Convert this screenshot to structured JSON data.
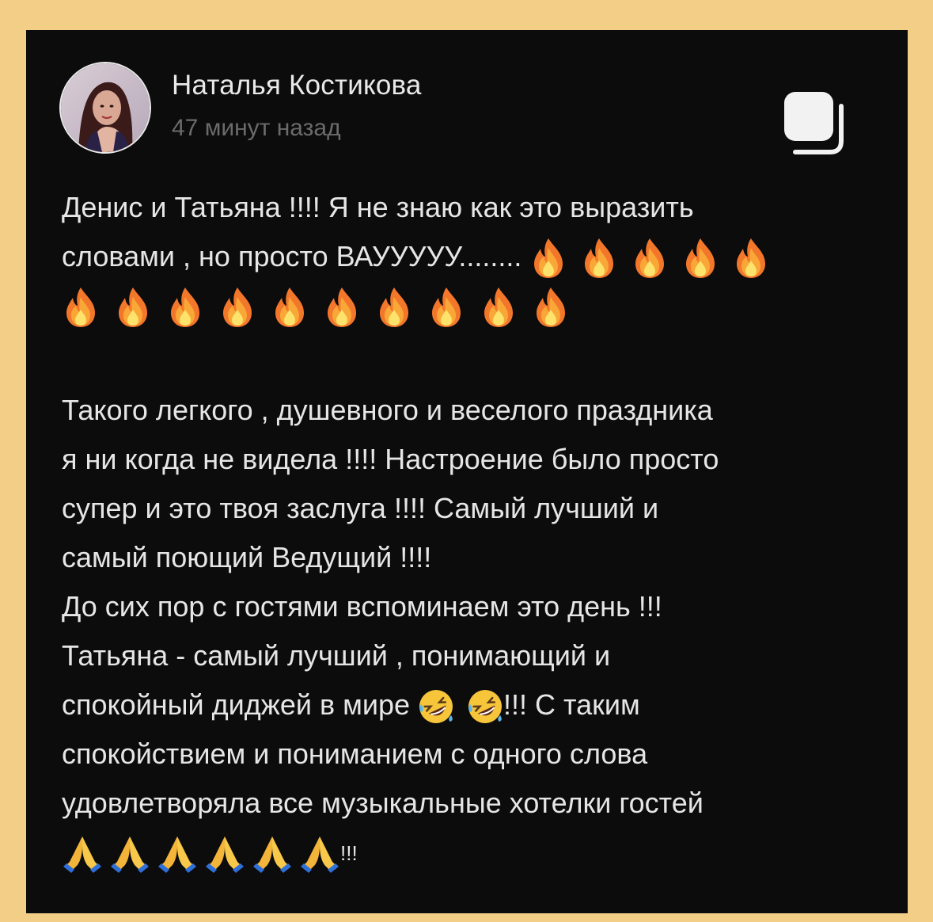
{
  "post": {
    "author": "Наталья Костикова",
    "time_ago": "47 минут назад",
    "paragraph1": {
      "line1": "Денис и Татьяна !!!! Я не знаю как это выразить",
      "line2": "словами , но просто ВАУУУУУ........"
    },
    "fire_emoji_count_line2": 5,
    "fire_emoji_count_line3": 10,
    "paragraph2": {
      "line1": "Такого легкого , душевного и веселого  праздника",
      "line2": "я ни когда не видела !!!! Настроение было просто",
      "line3": "супер и это твоя заслуга !!!! Самый лучший и",
      "line4": "самый поющий Ведущий !!!!",
      "line5": "До сих пор с гостями вспоминаем это день !!!",
      "line6": "Татьяна - самый лучший , понимающий и",
      "line7_start": "спокойный диджей в мире ",
      "line7_end": "!!! С таким",
      "line8": "спокойствием и пониманием с одного слова",
      "line9": "удовлетворяла все музыкальные хотелки гостей",
      "line10_end": "!!!"
    },
    "emoji": {
      "fire": "fire-emoji",
      "laugh": "rolling-on-floor-laughing-emoji",
      "pray": "folded-hands-emoji",
      "laugh_count": 2,
      "pray_count": 6
    }
  },
  "colors": {
    "page_background": "#f2ce86",
    "card_background": "#0c0c0c",
    "text": "#e6e6e6",
    "muted_text": "#6b6b6b"
  }
}
